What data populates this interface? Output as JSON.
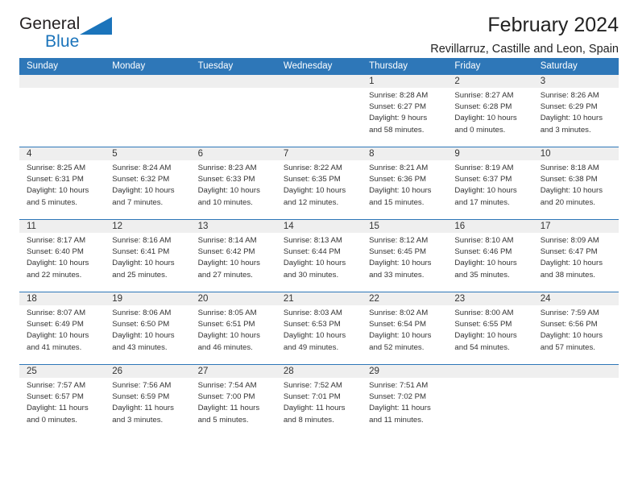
{
  "brand": {
    "name_part1": "General",
    "name_part2": "Blue",
    "triangle_icon": "triangle-icon",
    "colors": {
      "dark": "#231f20",
      "blue": "#1b74bb"
    }
  },
  "header": {
    "title": "February 2024",
    "subtitle": "Revillarruz, Castille and Leon, Spain"
  },
  "calendar": {
    "accent_color": "#2e77b8",
    "weekday_band_color": "#2e77b8",
    "daynumber_band_color": "#efefef",
    "weekdays": [
      "Sunday",
      "Monday",
      "Tuesday",
      "Wednesday",
      "Thursday",
      "Friday",
      "Saturday"
    ],
    "labels": {
      "sunrise": "Sunrise:",
      "sunset": "Sunset:",
      "daylight": "Daylight:"
    },
    "weeks": [
      [
        {
          "day": "",
          "empty": true
        },
        {
          "day": "",
          "empty": true
        },
        {
          "day": "",
          "empty": true
        },
        {
          "day": "",
          "empty": true
        },
        {
          "day": "1",
          "sunrise": "Sunrise: 8:28 AM",
          "sunset": "Sunset: 6:27 PM",
          "daylight1": "Daylight: 9 hours",
          "daylight2": "and 58 minutes."
        },
        {
          "day": "2",
          "sunrise": "Sunrise: 8:27 AM",
          "sunset": "Sunset: 6:28 PM",
          "daylight1": "Daylight: 10 hours",
          "daylight2": "and 0 minutes."
        },
        {
          "day": "3",
          "sunrise": "Sunrise: 8:26 AM",
          "sunset": "Sunset: 6:29 PM",
          "daylight1": "Daylight: 10 hours",
          "daylight2": "and 3 minutes."
        }
      ],
      [
        {
          "day": "4",
          "sunrise": "Sunrise: 8:25 AM",
          "sunset": "Sunset: 6:31 PM",
          "daylight1": "Daylight: 10 hours",
          "daylight2": "and 5 minutes."
        },
        {
          "day": "5",
          "sunrise": "Sunrise: 8:24 AM",
          "sunset": "Sunset: 6:32 PM",
          "daylight1": "Daylight: 10 hours",
          "daylight2": "and 7 minutes."
        },
        {
          "day": "6",
          "sunrise": "Sunrise: 8:23 AM",
          "sunset": "Sunset: 6:33 PM",
          "daylight1": "Daylight: 10 hours",
          "daylight2": "and 10 minutes."
        },
        {
          "day": "7",
          "sunrise": "Sunrise: 8:22 AM",
          "sunset": "Sunset: 6:35 PM",
          "daylight1": "Daylight: 10 hours",
          "daylight2": "and 12 minutes."
        },
        {
          "day": "8",
          "sunrise": "Sunrise: 8:21 AM",
          "sunset": "Sunset: 6:36 PM",
          "daylight1": "Daylight: 10 hours",
          "daylight2": "and 15 minutes."
        },
        {
          "day": "9",
          "sunrise": "Sunrise: 8:19 AM",
          "sunset": "Sunset: 6:37 PM",
          "daylight1": "Daylight: 10 hours",
          "daylight2": "and 17 minutes."
        },
        {
          "day": "10",
          "sunrise": "Sunrise: 8:18 AM",
          "sunset": "Sunset: 6:38 PM",
          "daylight1": "Daylight: 10 hours",
          "daylight2": "and 20 minutes."
        }
      ],
      [
        {
          "day": "11",
          "sunrise": "Sunrise: 8:17 AM",
          "sunset": "Sunset: 6:40 PM",
          "daylight1": "Daylight: 10 hours",
          "daylight2": "and 22 minutes."
        },
        {
          "day": "12",
          "sunrise": "Sunrise: 8:16 AM",
          "sunset": "Sunset: 6:41 PM",
          "daylight1": "Daylight: 10 hours",
          "daylight2": "and 25 minutes."
        },
        {
          "day": "13",
          "sunrise": "Sunrise: 8:14 AM",
          "sunset": "Sunset: 6:42 PM",
          "daylight1": "Daylight: 10 hours",
          "daylight2": "and 27 minutes."
        },
        {
          "day": "14",
          "sunrise": "Sunrise: 8:13 AM",
          "sunset": "Sunset: 6:44 PM",
          "daylight1": "Daylight: 10 hours",
          "daylight2": "and 30 minutes."
        },
        {
          "day": "15",
          "sunrise": "Sunrise: 8:12 AM",
          "sunset": "Sunset: 6:45 PM",
          "daylight1": "Daylight: 10 hours",
          "daylight2": "and 33 minutes."
        },
        {
          "day": "16",
          "sunrise": "Sunrise: 8:10 AM",
          "sunset": "Sunset: 6:46 PM",
          "daylight1": "Daylight: 10 hours",
          "daylight2": "and 35 minutes."
        },
        {
          "day": "17",
          "sunrise": "Sunrise: 8:09 AM",
          "sunset": "Sunset: 6:47 PM",
          "daylight1": "Daylight: 10 hours",
          "daylight2": "and 38 minutes."
        }
      ],
      [
        {
          "day": "18",
          "sunrise": "Sunrise: 8:07 AM",
          "sunset": "Sunset: 6:49 PM",
          "daylight1": "Daylight: 10 hours",
          "daylight2": "and 41 minutes."
        },
        {
          "day": "19",
          "sunrise": "Sunrise: 8:06 AM",
          "sunset": "Sunset: 6:50 PM",
          "daylight1": "Daylight: 10 hours",
          "daylight2": "and 43 minutes."
        },
        {
          "day": "20",
          "sunrise": "Sunrise: 8:05 AM",
          "sunset": "Sunset: 6:51 PM",
          "daylight1": "Daylight: 10 hours",
          "daylight2": "and 46 minutes."
        },
        {
          "day": "21",
          "sunrise": "Sunrise: 8:03 AM",
          "sunset": "Sunset: 6:53 PM",
          "daylight1": "Daylight: 10 hours",
          "daylight2": "and 49 minutes."
        },
        {
          "day": "22",
          "sunrise": "Sunrise: 8:02 AM",
          "sunset": "Sunset: 6:54 PM",
          "daylight1": "Daylight: 10 hours",
          "daylight2": "and 52 minutes."
        },
        {
          "day": "23",
          "sunrise": "Sunrise: 8:00 AM",
          "sunset": "Sunset: 6:55 PM",
          "daylight1": "Daylight: 10 hours",
          "daylight2": "and 54 minutes."
        },
        {
          "day": "24",
          "sunrise": "Sunrise: 7:59 AM",
          "sunset": "Sunset: 6:56 PM",
          "daylight1": "Daylight: 10 hours",
          "daylight2": "and 57 minutes."
        }
      ],
      [
        {
          "day": "25",
          "sunrise": "Sunrise: 7:57 AM",
          "sunset": "Sunset: 6:57 PM",
          "daylight1": "Daylight: 11 hours",
          "daylight2": "and 0 minutes."
        },
        {
          "day": "26",
          "sunrise": "Sunrise: 7:56 AM",
          "sunset": "Sunset: 6:59 PM",
          "daylight1": "Daylight: 11 hours",
          "daylight2": "and 3 minutes."
        },
        {
          "day": "27",
          "sunrise": "Sunrise: 7:54 AM",
          "sunset": "Sunset: 7:00 PM",
          "daylight1": "Daylight: 11 hours",
          "daylight2": "and 5 minutes."
        },
        {
          "day": "28",
          "sunrise": "Sunrise: 7:52 AM",
          "sunset": "Sunset: 7:01 PM",
          "daylight1": "Daylight: 11 hours",
          "daylight2": "and 8 minutes."
        },
        {
          "day": "29",
          "sunrise": "Sunrise: 7:51 AM",
          "sunset": "Sunset: 7:02 PM",
          "daylight1": "Daylight: 11 hours",
          "daylight2": "and 11 minutes."
        },
        {
          "day": "",
          "empty": true
        },
        {
          "day": "",
          "empty": true
        }
      ]
    ]
  }
}
